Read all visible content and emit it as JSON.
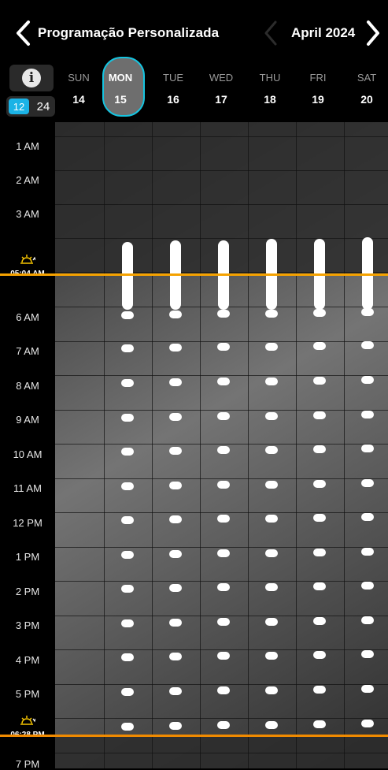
{
  "header": {
    "back_icon": "chevron-left-icon",
    "title": "Programação Personalizada",
    "prev_month_icon": "chevron-left-icon",
    "month": "April 2024",
    "next_month_icon": "chevron-right-icon"
  },
  "controls": {
    "info_label": "i",
    "format_12": "12",
    "format_24": "24",
    "selected_format": "12"
  },
  "days": [
    {
      "name": "SUN",
      "num": "14"
    },
    {
      "name": "MON",
      "num": "15",
      "selected": true
    },
    {
      "name": "TUE",
      "num": "16"
    },
    {
      "name": "WED",
      "num": "17"
    },
    {
      "name": "THU",
      "num": "18"
    },
    {
      "name": "FRI",
      "num": "19"
    },
    {
      "name": "SAT",
      "num": "20"
    }
  ],
  "hours": [
    "1 AM",
    "2 AM",
    "3 AM",
    "6 AM",
    "7 AM",
    "8 AM",
    "9 AM",
    "10 AM",
    "11 AM",
    "12 PM",
    "1 PM",
    "2 PM",
    "3 PM",
    "4 PM",
    "5 PM",
    "7 PM"
  ],
  "sunrise": {
    "time": "05:04 AM",
    "icon": "sunrise-icon"
  },
  "sunset": {
    "time": "06:28 PM",
    "icon": "sunset-icon"
  },
  "colors": {
    "accent": "#16c4e0",
    "sunrise": "#f5a200",
    "sunset": "#f08a00"
  }
}
